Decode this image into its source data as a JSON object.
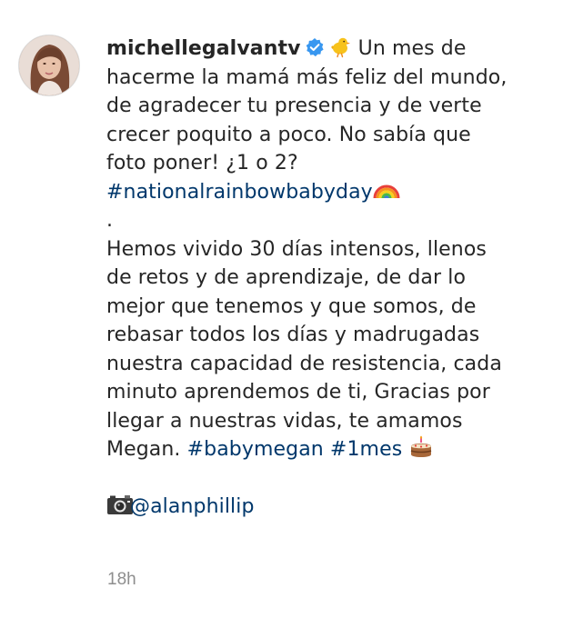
{
  "post": {
    "username": "michellegalvantv",
    "verified_icon": "verified-badge-icon",
    "caption_lines": [
      "Un mes de",
      "hacerme la mamá más feliz del mundo,",
      "de agradecer tu presencia y de verte",
      "crecer poquito a poco. No sabía que",
      "foto poner! ¿1 o 2?"
    ],
    "hashtag_rainbow": "#nationalrainbowbabyday",
    "dot_line": ".",
    "body_lines": [
      "Hemos vivido 30 días intensos, llenos",
      "de retos y de aprendizaje, de dar lo",
      "mejor que tenemos y que somos, de",
      "rebasar todos los días y madrugadas",
      "nuestra capacidad de resistencia, cada",
      "minuto aprendemos de ti, Gracias por",
      "llegar a nuestras vidas, te amamos"
    ],
    "last_line_text": "Megan.",
    "hashtag_babymegan": "#babymegan",
    "hashtag_1mes": "#1mes",
    "photo_credit_handle": "@alanphillip",
    "timestamp": "18h",
    "colors": {
      "text": "#262626",
      "link": "#00376b",
      "muted": "#8e8e8e",
      "verified": "#3897f0"
    }
  }
}
